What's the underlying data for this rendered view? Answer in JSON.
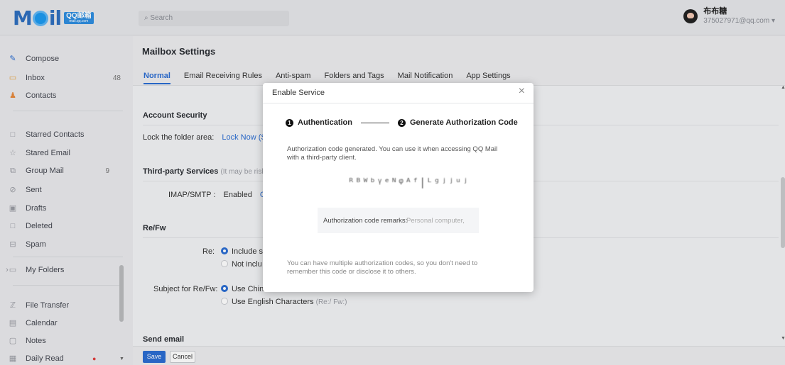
{
  "header": {
    "logo": {
      "m": "M",
      "il": "il",
      "qq": "QQ邮箱",
      "domain": "mail.qq.com"
    },
    "search_placeholder": "Search",
    "user": {
      "name": "布布糖",
      "email": "375027971@qq.com ▾"
    }
  },
  "sidebar": {
    "items": [
      {
        "label": "Compose",
        "icon": "compose-icon"
      },
      {
        "label": "Inbox",
        "count": "48",
        "icon": "inbox-icon"
      },
      {
        "label": "Contacts",
        "icon": "contacts-icon"
      },
      {
        "label": "Starred Contacts",
        "icon": "starred-contacts-icon"
      },
      {
        "label": "Stared Email",
        "icon": "star-icon"
      },
      {
        "label": "Group Mail",
        "count": "9",
        "icon": "group-icon"
      },
      {
        "label": "Sent",
        "icon": "sent-icon"
      },
      {
        "label": "Drafts",
        "icon": "drafts-icon"
      },
      {
        "label": "Deleted",
        "icon": "trash-icon"
      },
      {
        "label": "Spam",
        "icon": "spam-icon"
      },
      {
        "label": "My Folders",
        "icon": "folder-icon"
      },
      {
        "label": "File Transfer",
        "icon": "file-transfer-icon"
      },
      {
        "label": "Calendar",
        "icon": "calendar-icon"
      },
      {
        "label": "Notes",
        "icon": "notes-icon"
      },
      {
        "label": "Daily Read",
        "icon": "daily-read-icon"
      }
    ]
  },
  "main": {
    "title": "Mailbox Settings",
    "tabs": [
      "Normal",
      "Email Receiving Rules",
      "Anti-spam",
      "Folders and Tags",
      "Mail Notification",
      "App Settings"
    ],
    "account_security": {
      "heading": "Account Security",
      "lock_label": "Lock the folder area:",
      "lock_link": "Lock Now (S"
    },
    "third_party": {
      "heading": "Third-party Services",
      "note": "(It may be risky",
      "imap_label": "IMAP/SMTP :",
      "imap_status": "Enabled",
      "imap_link": "G"
    },
    "refw": {
      "heading": "Re/Fw",
      "re_label": "Re:",
      "re_opt1": "Include s",
      "re_opt2": "Not inclu",
      "subject_label": "Subject for Re/Fw:",
      "subj_opt1": "Use Chine",
      "subj_opt2": "Use English Characters",
      "subj_opt2_note": "(Re:/ Fw:)"
    },
    "send_email_heading": "Send email",
    "save_label": "Save",
    "cancel_label": "Cancel"
  },
  "modal": {
    "title": "Enable Service",
    "step1_num": "1",
    "step1": "Authentication",
    "step2_num": "2",
    "step2": "Generate Authorization Code",
    "desc": "Authorization code generated. You can use it when accessing QQ Mail with a third-party client.",
    "code": "ᴿᴮᵂᵇᵞᵉᴺᵠᴬᶠ|ᴸᵍʲʲᵘʲ",
    "remarks_label": "Authorization code remarks:",
    "remarks_value": "Personal computer,",
    "footer": "You can have multiple authorization codes, so you don't need to remember this code or disclose it to others."
  }
}
